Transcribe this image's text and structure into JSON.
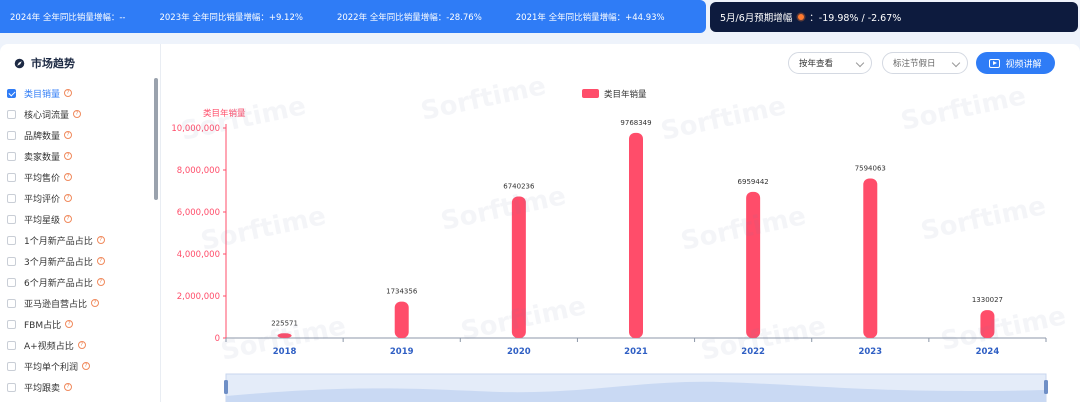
{
  "topbar": {
    "y2024": "2024年 全年同比销量增幅：--",
    "y2023": "2023年 全年同比销量增幅：+9.12%",
    "y2022": "2022年 全年同比销量增幅：-28.76%",
    "y2021": "2021年 全年同比销量增幅：+44.93%"
  },
  "forecast": {
    "label": "5月/6月预期增幅",
    "value": "：-19.98% / -2.67%"
  },
  "panel": {
    "title": "市场趋势",
    "year_select": "按年查看",
    "holiday_select": "标注节假日",
    "video_button": "视频讲解"
  },
  "sidebar": {
    "items": [
      {
        "label": "类目销量",
        "checked": true
      },
      {
        "label": "核心词流量",
        "checked": false
      },
      {
        "label": "品牌数量",
        "checked": false
      },
      {
        "label": "卖家数量",
        "checked": false
      },
      {
        "label": "平均售价",
        "checked": false
      },
      {
        "label": "平均评价",
        "checked": false
      },
      {
        "label": "平均星级",
        "checked": false
      },
      {
        "label": "1个月新产品占比",
        "checked": false
      },
      {
        "label": "3个月新产品占比",
        "checked": false
      },
      {
        "label": "6个月新产品占比",
        "checked": false
      },
      {
        "label": "亚马逊自营占比",
        "checked": false
      },
      {
        "label": "FBM占比",
        "checked": false
      },
      {
        "label": "A+视频占比",
        "checked": false
      },
      {
        "label": "平均单个利润",
        "checked": false
      },
      {
        "label": "平均跟卖",
        "checked": false
      }
    ]
  },
  "watermark": "Sorftime",
  "colors": {
    "accent": "#2f7cf6",
    "bar": "#ff4d6a",
    "dark": "#0d1b3e"
  },
  "chart_data": {
    "type": "bar",
    "categories": [
      "2018",
      "2019",
      "2020",
      "2021",
      "2022",
      "2023",
      "2024"
    ],
    "series": [
      {
        "name": "类目年销量",
        "values": [
          225571,
          1734356,
          6740236,
          9768349,
          6959442,
          7594063,
          1330027
        ]
      }
    ],
    "ylabel": "类目年销量",
    "ylim": [
      0,
      10000000
    ],
    "yticks": [
      "0",
      "2,000,000",
      "4,000,000",
      "6,000,000",
      "8,000,000",
      "10,000,000"
    ],
    "legend": "top-center",
    "grid": false
  }
}
